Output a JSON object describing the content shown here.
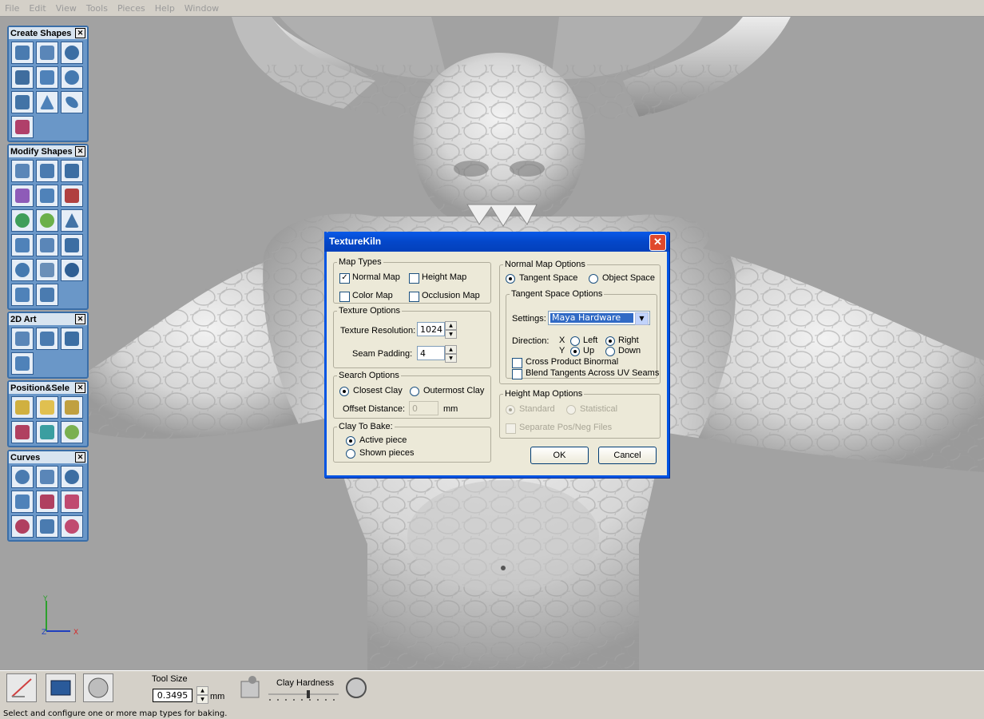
{
  "menu": [
    "File",
    "Edit",
    "View",
    "Tools",
    "Pieces",
    "Help",
    "Window"
  ],
  "palettes": [
    {
      "title": "Create Shapes",
      "rows": 4,
      "count": 10
    },
    {
      "title": "Modify Shapes",
      "count": 17
    },
    {
      "title": "2D Art",
      "count": 4
    },
    {
      "title": "Position&Sele",
      "count": 6
    },
    {
      "title": "Curves",
      "count": 9
    }
  ],
  "axis": {
    "y": "Y",
    "z": "Z",
    "x": "X"
  },
  "toolbar": {
    "tool_size_label": "Tool Size",
    "tool_size_value": "0.3495",
    "tool_size_unit": "mm",
    "clay_hardness_label": "Clay Hardness"
  },
  "status": "Select and configure one or more map types for baking.",
  "dialog": {
    "title": "TextureKiln",
    "map_types": {
      "legend": "Map Types",
      "normal_map": "Normal Map",
      "height_map": "Height Map",
      "color_map": "Color Map",
      "occlusion_map": "Occlusion Map"
    },
    "texture_options": {
      "legend": "Texture Options",
      "resolution_label": "Texture Resolution:",
      "resolution_value": "1024",
      "padding_label": "Seam Padding:",
      "padding_value": "4"
    },
    "search_options": {
      "legend": "Search Options",
      "closest": "Closest Clay",
      "outermost": "Outermost Clay",
      "offset_label": "Offset Distance:",
      "offset_value": "0",
      "offset_unit": "mm"
    },
    "clay_to_bake": {
      "legend": "Clay To Bake:",
      "active": "Active piece",
      "shown": "Shown pieces"
    },
    "normal_map_options": {
      "legend": "Normal Map Options",
      "tangent": "Tangent Space",
      "object": "Object Space"
    },
    "tangent_space_options": {
      "legend": "Tangent Space Options",
      "settings_label": "Settings:",
      "settings_value": "Maya Hardware",
      "direction_label": "Direction:",
      "x_label": "X",
      "y_label": "Y",
      "left": "Left",
      "right": "Right",
      "up": "Up",
      "down": "Down",
      "cross_product": "Cross Product Binormal",
      "blend_tangents": "Blend Tangents Across UV Seams"
    },
    "height_map_options": {
      "legend": "Height Map Options",
      "standard": "Standard",
      "statistical": "Statistical",
      "separate": "Separate Pos/Neg Files"
    },
    "ok": "OK",
    "cancel": "Cancel"
  }
}
